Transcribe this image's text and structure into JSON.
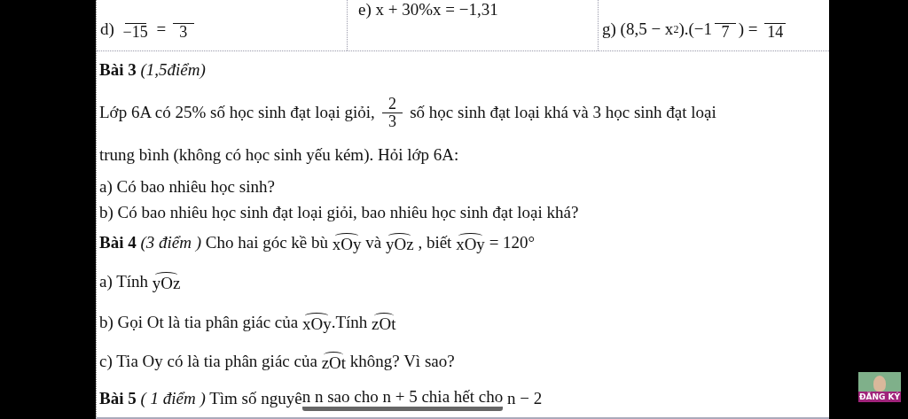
{
  "top_row": [
    {
      "segments": [
        {
          "kind": "text",
          "text": "d) "
        },
        {
          "kind": "frac",
          "den": "−15"
        },
        {
          "kind": "text",
          "text": " = "
        },
        {
          "kind": "frac",
          "den": "3"
        }
      ]
    },
    {
      "segments": [
        {
          "kind": "text",
          "text": "e) x + 30%x = −1,31"
        }
      ]
    },
    {
      "segments": [
        {
          "kind": "text",
          "text": "g) (8,5 − x"
        },
        {
          "kind": "sup",
          "text": "2"
        },
        {
          "kind": "text",
          "text": ").(−1"
        },
        {
          "kind": "frac",
          "den": "7"
        },
        {
          "kind": "text",
          "text": ") = "
        },
        {
          "kind": "frac",
          "den": "14"
        }
      ]
    }
  ],
  "lines": [
    {
      "segments": [
        {
          "kind": "text",
          "text": "**Bài 3** *(1,5điểm)*"
        }
      ]
    },
    {
      "segments": [
        {
          "kind": "text",
          "text": "Lớp 6A có 25% số học sinh đạt loại giỏi, "
        },
        {
          "kind": "frac",
          "num": "2",
          "den": "3"
        },
        {
          "kind": "text",
          "text": " số học sinh đạt loại khá và 3 học sinh đạt loại"
        }
      ]
    },
    {
      "segments": [
        {
          "kind": "text",
          "text": "trung bình (không có học sinh yếu kém). Hỏi lớp 6A:"
        }
      ]
    },
    {
      "segments": [
        {
          "kind": "text",
          "text": "a) Có bao nhiêu học sinh?"
        }
      ]
    },
    {
      "segments": [
        {
          "kind": "text",
          "text": "b) Có bao nhiêu học sinh đạt loại giỏi, bao nhiêu học sinh đạt loại khá?"
        }
      ]
    },
    {
      "segments": [
        {
          "kind": "text",
          "text": "**Bài 4** *(3 điểm )* Cho hai góc kề bù "
        },
        {
          "kind": "angle",
          "text": "xOy"
        },
        {
          "kind": "text",
          "text": " và "
        },
        {
          "kind": "angle",
          "text": "yOz"
        },
        {
          "kind": "text",
          "text": " , biết "
        },
        {
          "kind": "angle",
          "text": "xOy"
        },
        {
          "kind": "text",
          "text": " = 120°"
        }
      ]
    },
    {
      "segments": [
        {
          "kind": "text",
          "text": "a) Tính "
        },
        {
          "kind": "angle",
          "text": "yOz"
        }
      ]
    },
    {
      "segments": [
        {
          "kind": "text",
          "text": "b) Gọi Ot là tia phân giác của "
        },
        {
          "kind": "angle",
          "text": "xOy"
        },
        {
          "kind": "text",
          "text": ".Tính "
        },
        {
          "kind": "angle",
          "text": "zOt"
        }
      ]
    },
    {
      "segments": [
        {
          "kind": "text",
          "text": "c) Tia Oy có là tia phân giác của "
        },
        {
          "kind": "angle",
          "text": "zOt"
        },
        {
          "kind": "text",
          "text": " không? Vì sao?"
        }
      ]
    },
    {
      "segments": [
        {
          "kind": "text",
          "text": "**Bài 5** *( 1 điểm )* Tìm số nguyê"
        },
        {
          "kind": "mark",
          "text": "n n sao cho n + 5 chia hết cho"
        },
        {
          "kind": "text",
          "text": " n − 2"
        }
      ]
    }
  ],
  "subscribe": {
    "label": "ĐĂNG KÝ"
  }
}
